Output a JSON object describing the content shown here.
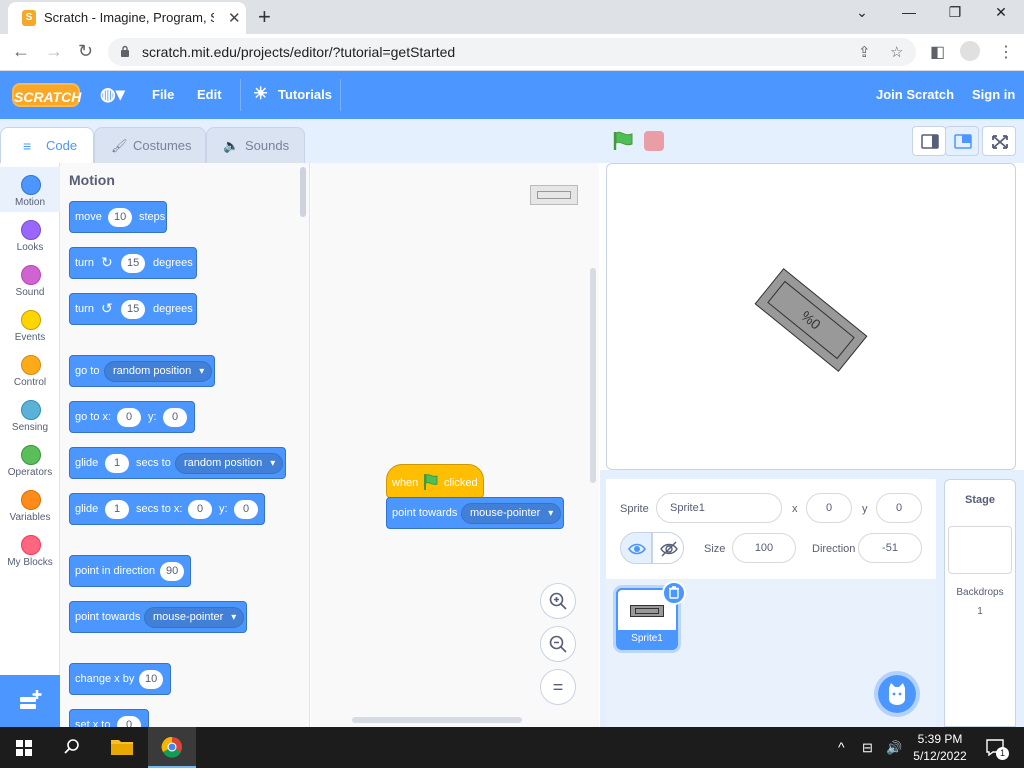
{
  "browser": {
    "tab_title": "Scratch - Imagine, Program, Share",
    "tab_favicon": "S",
    "tab_close": "✕",
    "new_tab": "+",
    "url": "scratch.mit.edu/projects/editor/?tutorial=getStarted",
    "window_controls": {
      "minimize": "⌄",
      "min2": "—",
      "restore": "❐",
      "close": "✕"
    }
  },
  "scratch_menu": {
    "logo": "SCRATCH",
    "file": "File",
    "edit": "Edit",
    "tutorials": "Tutorials",
    "join": "Join Scratch",
    "signin": "Sign in"
  },
  "editor_tabs": {
    "code": "Code",
    "costumes": "Costumes",
    "sounds": "Sounds"
  },
  "categories": [
    {
      "label": "Motion",
      "color": "#4c97ff"
    },
    {
      "label": "Looks",
      "color": "#9966ff"
    },
    {
      "label": "Sound",
      "color": "#cf63cf"
    },
    {
      "label": "Events",
      "color": "#ffd500"
    },
    {
      "label": "Control",
      "color": "#ffab19"
    },
    {
      "label": "Sensing",
      "color": "#5cb1d6"
    },
    {
      "label": "Operators",
      "color": "#59c059"
    },
    {
      "label": "Variables",
      "color": "#ff8c1a"
    },
    {
      "label": "My Blocks",
      "color": "#ff6680"
    }
  ],
  "palette": {
    "title": "Motion",
    "move": {
      "text1": "move",
      "steps_value": "10",
      "text2": "steps"
    },
    "turn_right": {
      "text1": "turn",
      "degrees_value": "15",
      "text2": "degrees"
    },
    "turn_left": {
      "text1": "turn",
      "degrees_value": "15",
      "text2": "degrees"
    },
    "goto": {
      "text1": "go to",
      "dropdown": "random position"
    },
    "goto_xy": {
      "text1": "go to x:",
      "x_value": "0",
      "text2": "y:",
      "y_value": "0"
    },
    "glide_random": {
      "text1": "glide",
      "secs_value": "1",
      "text2": "secs to",
      "dropdown": "random position"
    },
    "glide_xy": {
      "text1": "glide",
      "secs_value": "1",
      "text2": "secs to x:",
      "x_value": "0",
      "text3": "y:",
      "y_value": "0"
    },
    "point_direction": {
      "text1": "point in direction",
      "value": "90"
    },
    "point_towards": {
      "text1": "point towards",
      "dropdown": "mouse-pointer"
    },
    "change_x": {
      "text1": "change x by",
      "value": "10"
    },
    "set_x": {
      "text1": "set x to",
      "value": "0"
    }
  },
  "script": {
    "hat": {
      "text1": "when",
      "text2": "clicked"
    },
    "point_towards": {
      "text1": "point towards",
      "dropdown": "mouse-pointer"
    }
  },
  "zoom": {
    "in": "+",
    "out": "−",
    "reset": "="
  },
  "stage_sprite_text": "%0",
  "sprite_info": {
    "sprite_label": "Sprite",
    "sprite_name": "Sprite1",
    "x_label": "x",
    "x_value": "0",
    "y_label": "y",
    "y_value": "0",
    "size_label": "Size",
    "size_value": "100",
    "direction_label": "Direction",
    "direction_value": "-51"
  },
  "sprite_list": [
    {
      "name": "Sprite1"
    }
  ],
  "stage_selector": {
    "title": "Stage",
    "backdrops_label": "Backdrops",
    "backdrops_count": "1"
  },
  "taskbar": {
    "time": "5:39 PM",
    "date": "5/12/2022",
    "notification_count": "1"
  }
}
